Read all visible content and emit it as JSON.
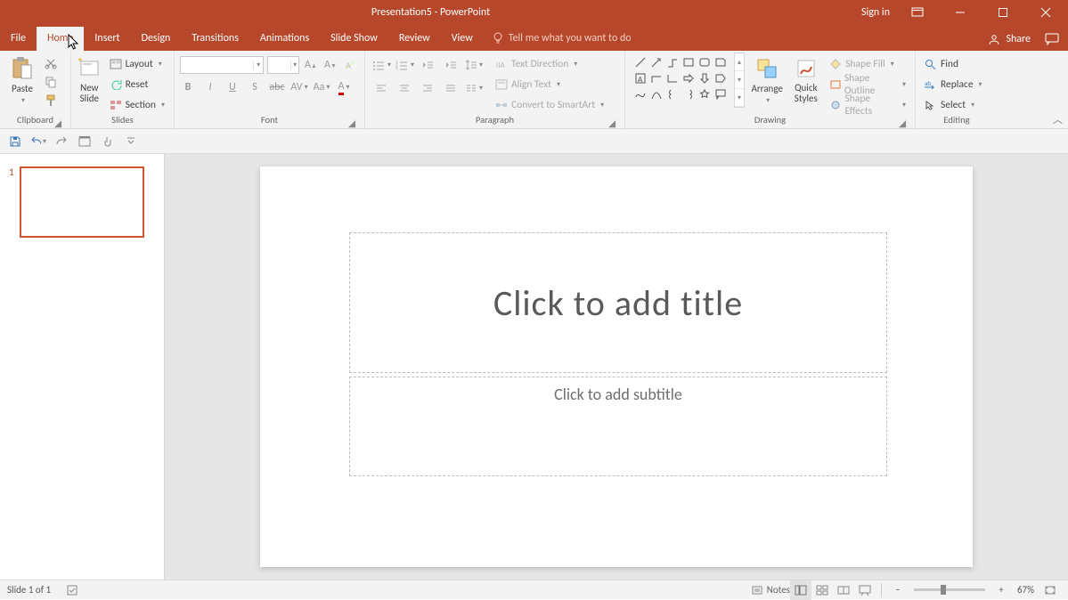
{
  "title": "Presentation5 - PowerPoint",
  "signin": "Sign in",
  "tabs": {
    "file": "File",
    "home": "Home",
    "insert": "Insert",
    "design": "Design",
    "transitions": "Transitions",
    "animations": "Animations",
    "slideshow": "Slide Show",
    "review": "Review",
    "view": "View",
    "tell": "Tell me what you want to do"
  },
  "share": "Share",
  "ribbon": {
    "clipboard": {
      "label": "Clipboard",
      "paste": "Paste"
    },
    "slides": {
      "label": "Slides",
      "newslide": "New\nSlide",
      "layout": "Layout",
      "reset": "Reset",
      "section": "Section"
    },
    "font": {
      "label": "Font",
      "name": "",
      "size": ""
    },
    "paragraph": {
      "label": "Paragraph",
      "textdir": "Text Direction",
      "align": "Align Text",
      "smartart": "Convert to SmartArt"
    },
    "drawing": {
      "label": "Drawing",
      "arrange": "Arrange",
      "quick": "Quick\nStyles",
      "shapefill": "Shape Fill",
      "shapeoutline": "Shape Outline",
      "shapeeffects": "Shape Effects"
    },
    "editing": {
      "label": "Editing",
      "find": "Find",
      "replace": "Replace",
      "select": "Select"
    }
  },
  "slide": {
    "number": "1",
    "title_ph": "Click to add title",
    "sub_ph": "Click to add subtitle"
  },
  "status": {
    "slide": "Slide 1 of 1",
    "notes": "Notes",
    "zoom": "67%"
  }
}
